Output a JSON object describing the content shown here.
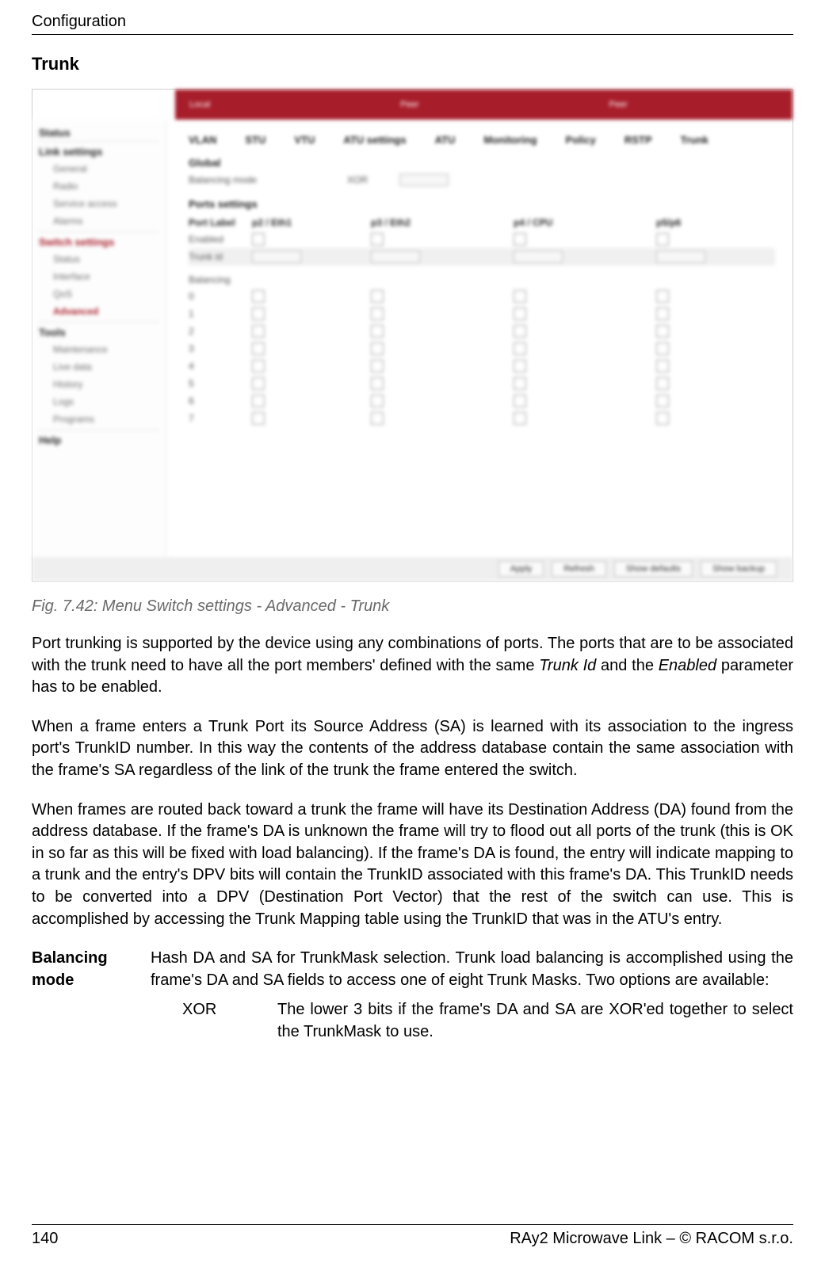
{
  "header": {
    "running_head": "Configuration"
  },
  "section": {
    "title": "Trunk"
  },
  "figure": {
    "caption": "Fig. 7.42: Menu Switch settings - Advanced - Trunk",
    "topbar": {
      "label_a": "Local",
      "label_b": "Peer",
      "label_c": "Peer"
    },
    "sidebar": {
      "groups": [
        {
          "head": "Status",
          "items": []
        },
        {
          "head": "Link settings",
          "items": [
            "General",
            "Radio",
            "Service access",
            "Alarms"
          ]
        },
        {
          "head": "Switch settings",
          "sel": true,
          "items": [
            "Status",
            "Interface",
            "QoS",
            "Advanced"
          ]
        },
        {
          "head": "Tools",
          "items": [
            "Maintenance",
            "Live data",
            "History",
            "Logs",
            "Programs"
          ]
        },
        {
          "head": "Help",
          "items": []
        }
      ]
    },
    "tabs": [
      "VLAN",
      "STU",
      "VTU",
      "ATU settings",
      "ATU",
      "Monitoring",
      "Policy",
      "RSTP",
      "Trunk"
    ],
    "global": {
      "head": "Global",
      "label": "Balancing mode",
      "value": "XOR"
    },
    "ports": {
      "head": "Ports settings",
      "cols": [
        "Port Label",
        "p2 / Eth1",
        "p3 / Eth2",
        "p4 / CPU",
        "p5/p6"
      ],
      "enabled_label": "Enabled",
      "trunkid_label": "Trunk id",
      "balancing_label": "Balancing",
      "rows": [
        "0",
        "1",
        "2",
        "3",
        "4",
        "5",
        "6",
        "7"
      ]
    },
    "buttons": [
      "Apply",
      "Refresh",
      "Show defaults",
      "Show backup"
    ]
  },
  "paragraphs": {
    "p1_a": "Port trunking is supported by the device using any combinations of ports. The ports that are to be associated with the trunk need to have all the port members' defined with the same ",
    "p1_term1": "Trunk Id",
    "p1_b": " and the ",
    "p1_term2": "Enabled",
    "p1_c": " parameter has to be enabled.",
    "p2": "When a frame enters a Trunk Port its Source Address (SA) is learned with its association to the ingress port's TrunkID number. In this way the contents of the address database contain the same association with the frame's SA regardless of the link of the trunk the frame entered the switch.",
    "p3": "When frames are routed back toward a trunk the frame will have its Destination Address (DA) found from the address database. If the frame's DA is unknown the frame will try to flood out all ports of the trunk (this is OK in so far as this will be fixed with load balancing). If the frame's DA is found, the entry will indicate mapping to a trunk and the entry's DPV bits will contain the TrunkID associated with this frame's DA. This TrunkID needs to be converted into a DPV (Destination Port Vector) that the rest of the switch can use. This is accomplished by accessing the Trunk Mapping table using the TrunkID that was in the ATU's entry."
  },
  "definition": {
    "term": "Balancing mode",
    "body": "Hash DA and SA for TrunkMask selection. Trunk load balancing is accomplished using the frame's DA and SA fields to access one of eight Trunk Masks. Two options are available:",
    "sub_key": "XOR",
    "sub_val": "The lower 3 bits if the frame's DA and SA are XOR'ed together to select the TrunkMask to use."
  },
  "footer": {
    "page": "140",
    "right": "RAy2 Microwave Link – © RACOM s.r.o."
  }
}
